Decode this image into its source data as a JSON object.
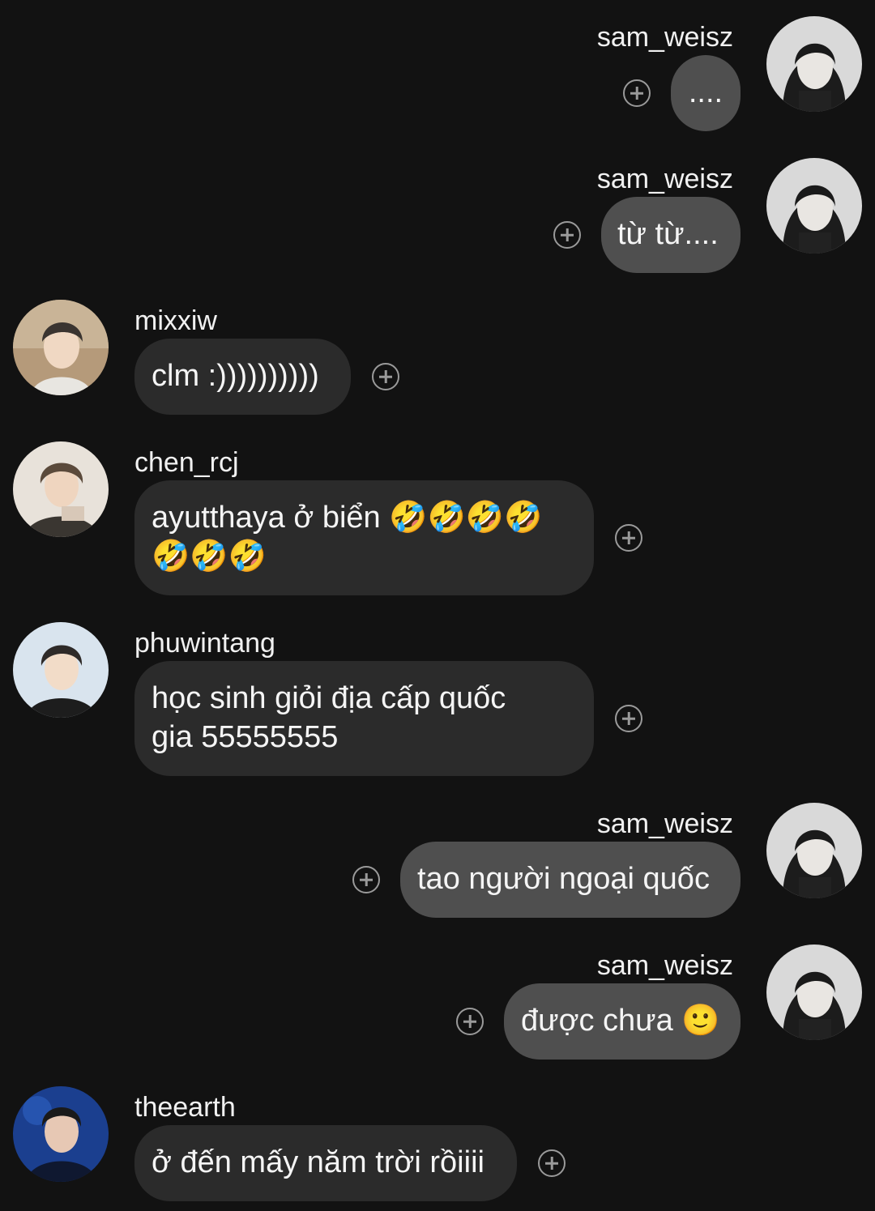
{
  "messages": [
    {
      "sender": "sam_weisz",
      "text": "....",
      "direction": "out"
    },
    {
      "sender": "sam_weisz",
      "text": "từ từ....",
      "direction": "out"
    },
    {
      "sender": "mixxiw",
      "text": "clm :))))))))))",
      "direction": "in"
    },
    {
      "sender": "chen_rcj",
      "text": "ayutthaya ở biển 🤣🤣🤣🤣\n🤣🤣🤣",
      "direction": "in"
    },
    {
      "sender": "phuwintang",
      "text": "học sinh giỏi địa cấp quốc\ngia 55555555",
      "direction": "in"
    },
    {
      "sender": "sam_weisz",
      "text": "tao người ngoại quốc",
      "direction": "out"
    },
    {
      "sender": "sam_weisz",
      "text": "được chưa 🙂",
      "direction": "out"
    },
    {
      "sender": "theearth",
      "text": "ở đến mấy năm trời rồiiii",
      "direction": "in"
    }
  ],
  "icons": {
    "reaction": "add-reaction-icon",
    "avatar": "user-avatar"
  },
  "colors": {
    "background": "#121212",
    "incoming_bubble": "#2b2b2b",
    "outgoing_bubble": "#4f4f4f",
    "text": "#f5f5f5",
    "react_icon": "#9a9a9a"
  }
}
